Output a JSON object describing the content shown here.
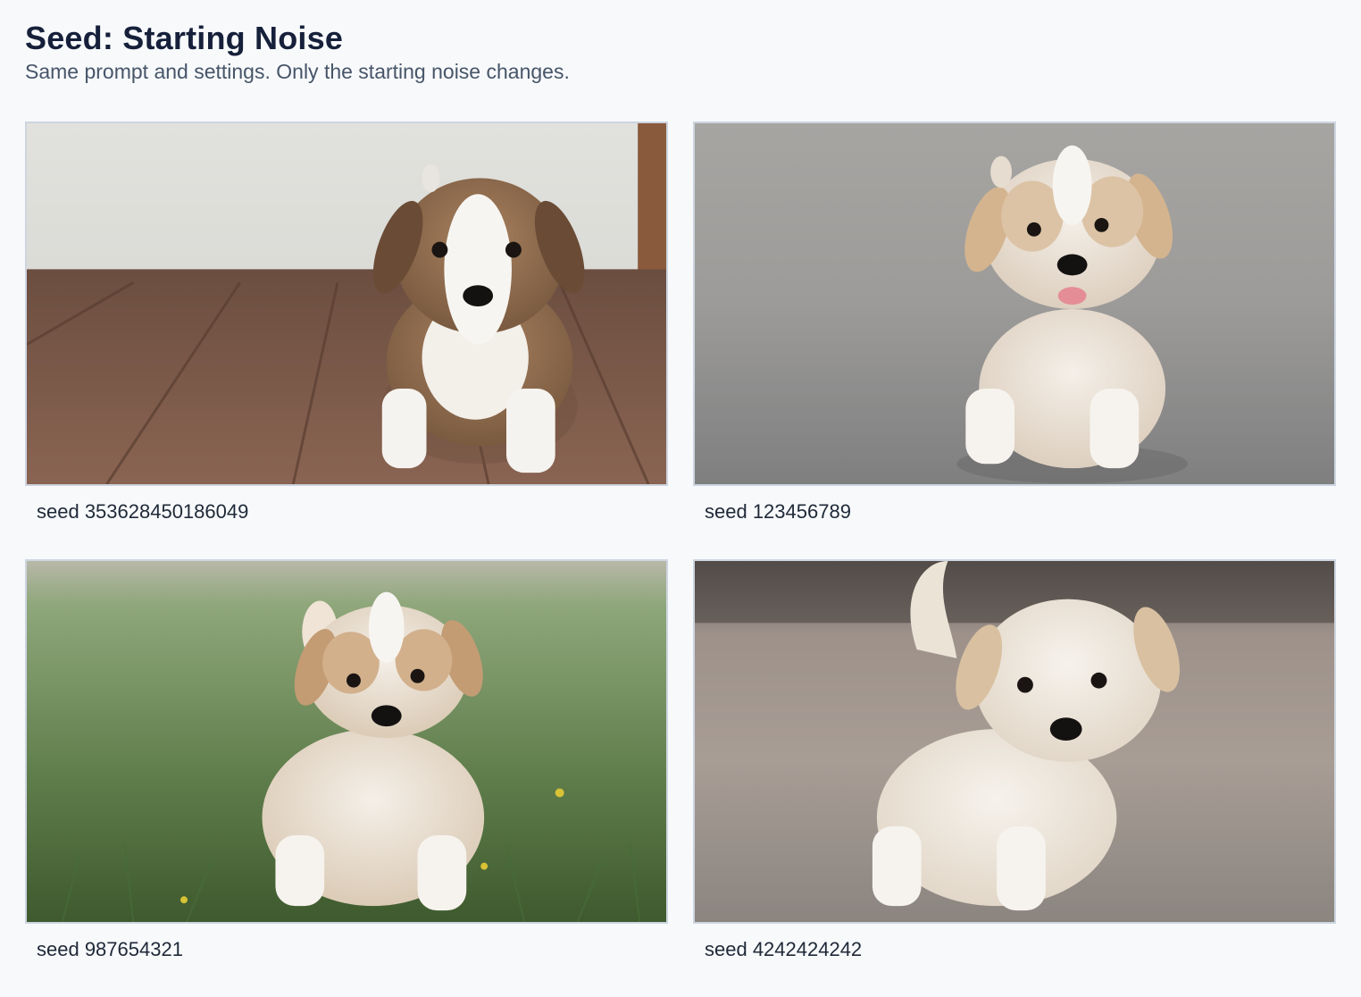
{
  "header": {
    "title": "Seed: Starting Noise",
    "subtitle": "Same prompt and settings. Only the starting noise changes."
  },
  "images": [
    {
      "caption": "seed 353628450186049",
      "description": "puppy-on-wood-deck"
    },
    {
      "caption": "seed 123456789",
      "description": "puppy-on-asphalt"
    },
    {
      "caption": "seed 987654321",
      "description": "puppy-in-grass"
    },
    {
      "caption": "seed 4242424242",
      "description": "puppy-on-pavement"
    }
  ]
}
